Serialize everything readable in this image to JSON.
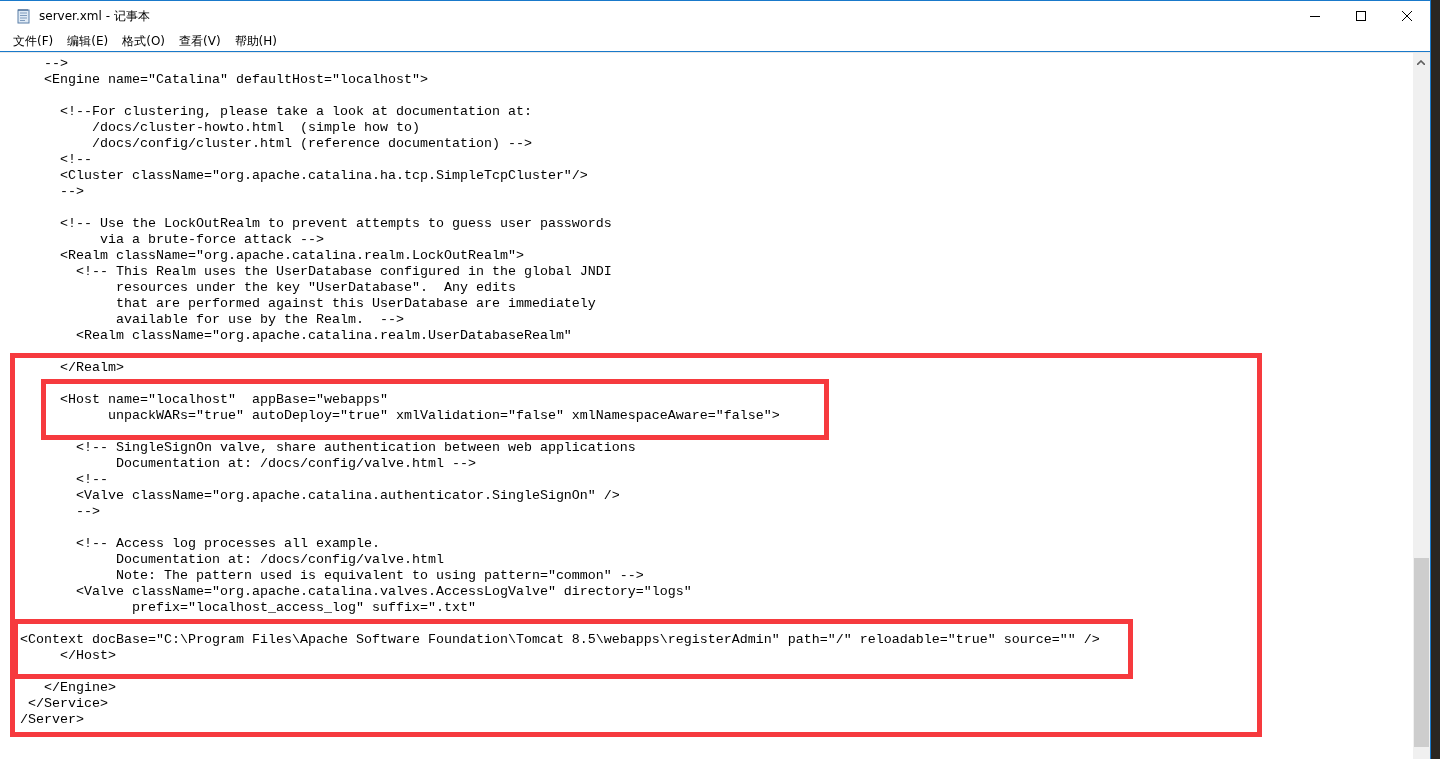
{
  "window": {
    "title": "server.xml - 记事本"
  },
  "menu": [
    "文件(F)",
    "编辑(E)",
    "格式(O)",
    "查看(V)",
    "帮助(H)"
  ],
  "editor": {
    "blocks": [
      [
        "    -->",
        "    <Engine name=\"Catalina\" defaultHost=\"localhost\">"
      ],
      [
        "      <!--For clustering, please take a look at documentation at:",
        "          /docs/cluster-howto.html  (simple how to)",
        "          /docs/config/cluster.html (reference documentation) -->",
        "      <!--",
        "      <Cluster className=\"org.apache.catalina.ha.tcp.SimpleTcpCluster\"/>",
        "      -->"
      ],
      [
        "      <!-- Use the LockOutRealm to prevent attempts to guess user passwords",
        "           via a brute-force attack -->",
        "      <Realm className=\"org.apache.catalina.realm.LockOutRealm\">",
        "        <!-- This Realm uses the UserDatabase configured in the global JNDI",
        "             resources under the key \"UserDatabase\".  Any edits",
        "             that are performed against this UserDatabase are immediately",
        "             available for use by the Realm.  -->",
        "        <Realm className=\"org.apache.catalina.realm.UserDatabaseRealm\""
      ],
      [
        "      </Realm>"
      ],
      [
        "      <Host name=\"localhost\"  appBase=\"webapps\"",
        "            unpackWARs=\"true\" autoDeploy=\"true\" xmlValidation=\"false\" xmlNamespaceAware=\"false\">"
      ],
      [
        "        <!-- SingleSignOn valve, share authentication between web applications",
        "             Documentation at: /docs/config/valve.html -->",
        "        <!--",
        "        <Valve className=\"org.apache.catalina.authenticator.SingleSignOn\" />",
        "        -->"
      ],
      [
        "        <!-- Access log processes all example.",
        "             Documentation at: /docs/config/valve.html",
        "             Note: The pattern used is equivalent to using pattern=\"common\" -->",
        "        <Valve className=\"org.apache.catalina.valves.AccessLogValve\" directory=\"logs\"",
        "               prefix=\"localhost_access_log\" suffix=\".txt\""
      ],
      [
        " <Context docBase=\"C:\\Program Files\\Apache Software Foundation\\Tomcat 8.5\\webapps\\registerAdmin\" path=\"/\" reloadable=\"true\" source=\"\" />",
        "      </Host>"
      ],
      [
        "    </Engine>",
        "  </Service>",
        " /Server>"
      ]
    ]
  }
}
